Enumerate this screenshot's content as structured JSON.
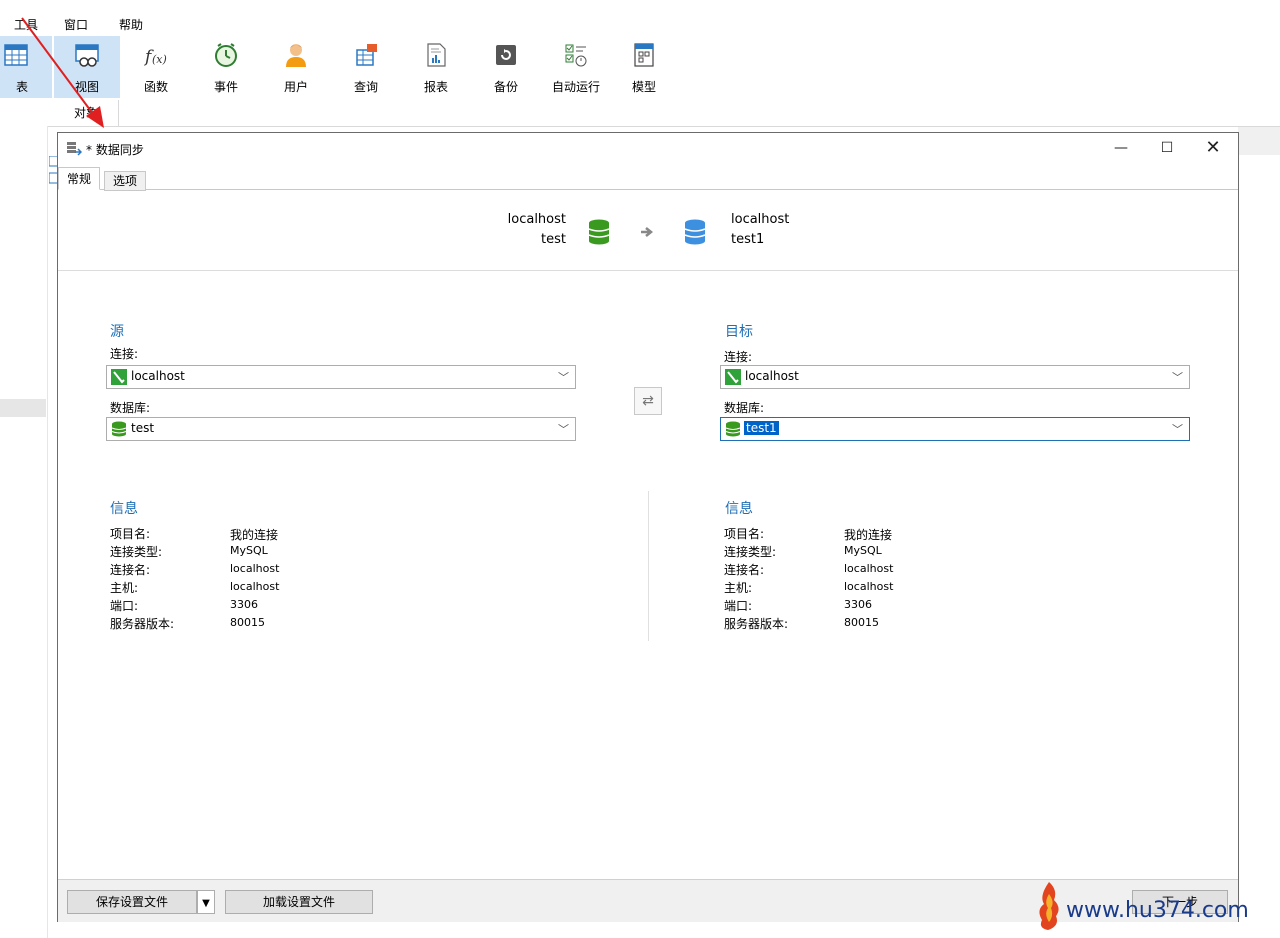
{
  "menu": {
    "items": [
      "工具",
      "窗口",
      "帮助"
    ]
  },
  "toolbar": {
    "buttons": [
      {
        "label": "表",
        "icon": "table-icon"
      },
      {
        "label": "视图",
        "icon": "view-icon"
      },
      {
        "label": "函数",
        "icon": "function-icon"
      },
      {
        "label": "事件",
        "icon": "event-clock-icon"
      },
      {
        "label": "用户",
        "icon": "user-icon"
      },
      {
        "label": "查询",
        "icon": "query-icon"
      },
      {
        "label": "报表",
        "icon": "report-icon"
      },
      {
        "label": "备份",
        "icon": "backup-icon"
      },
      {
        "label": "自动运行",
        "icon": "autorun-icon"
      },
      {
        "label": "模型",
        "icon": "model-icon"
      }
    ]
  },
  "object_tab": {
    "label": "对象"
  },
  "dialog": {
    "title": "* 数据同步",
    "tabs": {
      "general": "常规",
      "options": "选项"
    },
    "summary": {
      "source_host": "localhost",
      "source_db": "test",
      "target_host": "localhost",
      "target_db": "test1"
    },
    "source": {
      "heading": "源",
      "connection_label": "连接:",
      "connection_value": "localhost",
      "database_label": "数据库:",
      "database_value": "test"
    },
    "target": {
      "heading": "目标",
      "connection_label": "连接:",
      "connection_value": "localhost",
      "database_label": "数据库:",
      "database_value": "test1"
    },
    "info_left": {
      "heading": "信息",
      "rows": [
        {
          "key": "项目名:",
          "value": "我的连接"
        },
        {
          "key": "连接类型:",
          "value": "MySQL"
        },
        {
          "key": "连接名:",
          "value": "localhost"
        },
        {
          "key": "主机:",
          "value": "localhost"
        },
        {
          "key": "端口:",
          "value": "3306"
        },
        {
          "key": "服务器版本:",
          "value": "80015"
        }
      ]
    },
    "info_right": {
      "heading": "信息",
      "rows": [
        {
          "key": "项目名:",
          "value": "我的连接"
        },
        {
          "key": "连接类型:",
          "value": "MySQL"
        },
        {
          "key": "连接名:",
          "value": "localhost"
        },
        {
          "key": "主机:",
          "value": "localhost"
        },
        {
          "key": "端口:",
          "value": "3306"
        },
        {
          "key": "服务器版本:",
          "value": "80015"
        }
      ]
    },
    "footer": {
      "save_profile": "保存设置文件",
      "load_profile": "加载设置文件",
      "next": "下一步"
    }
  },
  "watermark": {
    "text": "www.hu374.com"
  },
  "colors": {
    "accent": "#1f6fb5",
    "selection": "#0063c7",
    "source_db": "#3a9a1f",
    "target_db": "#3d8fe0",
    "annotation_arrow": "#e02020"
  }
}
